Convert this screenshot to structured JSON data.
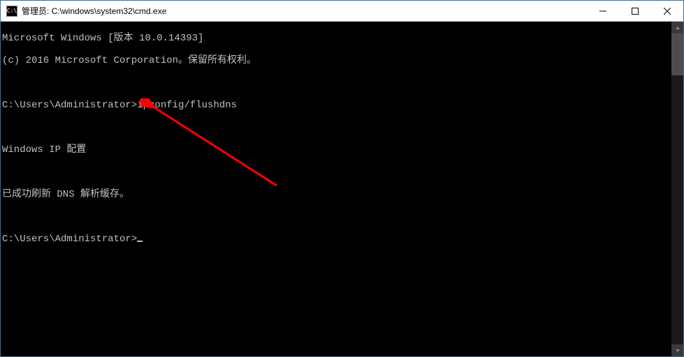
{
  "window": {
    "title": "管理员: C:\\windows\\system32\\cmd.exe",
    "icon_label": "C:\\"
  },
  "terminal": {
    "lines": [
      "Microsoft Windows [版本 10.0.14393]",
      "(c) 2016 Microsoft Corporation。保留所有权利。",
      "",
      "C:\\Users\\Administrator>ipconfig/flushdns",
      "",
      "Windows IP 配置",
      "",
      "已成功刷新 DNS 解析缓存。",
      "",
      "C:\\Users\\Administrator>"
    ]
  },
  "annotation": {
    "arrow_color": "#ff0000"
  }
}
